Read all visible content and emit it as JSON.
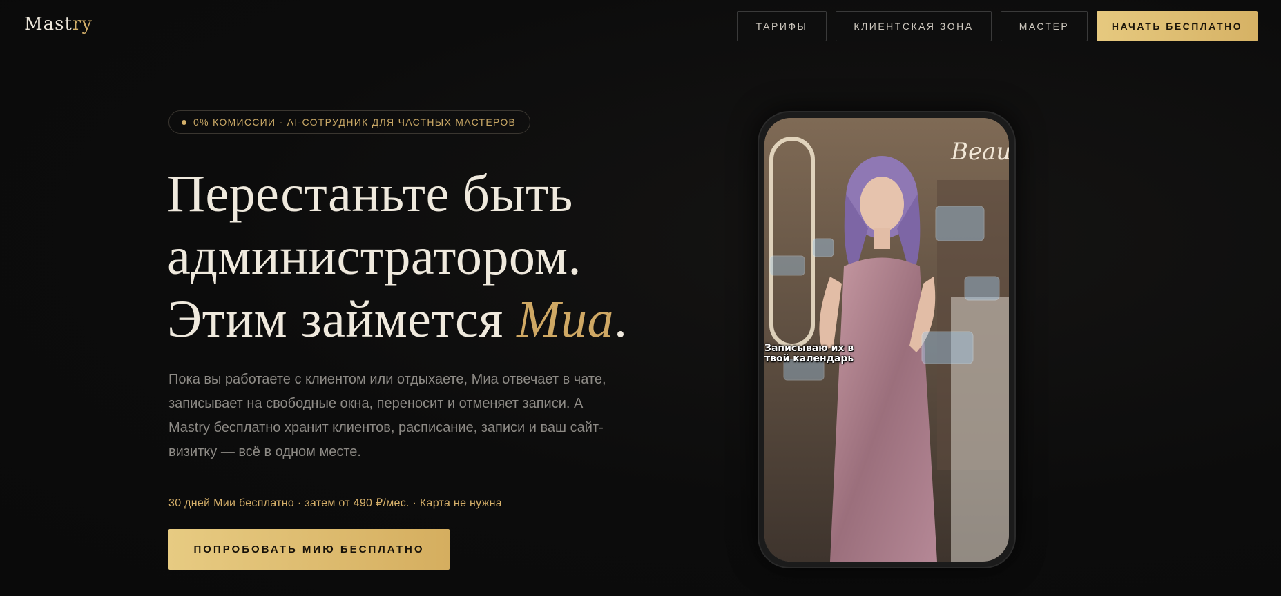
{
  "header": {
    "logo_main": "Mast",
    "logo_accent": "ry",
    "nav": {
      "pricing": "ТАРИФЫ",
      "client_zone": "КЛИЕНТСКАЯ ЗОНА",
      "master": "МАСТЕР",
      "start_free": "НАЧАТЬ БЕСПЛАТНО"
    }
  },
  "hero": {
    "badge": "0% КОМИССИИ · AI-СОТРУДНИК ДЛЯ ЧАСТНЫХ МАСТЕРОВ",
    "headline_line1": "Перестаньте быть",
    "headline_line2": "администратором.",
    "headline_line3_prefix": "Этим займется ",
    "headline_accent": "Миа",
    "headline_period": ".",
    "description": "Пока вы работаете с клиентом или отдыхаете, Миа отвечает в чате, записывает на свободные окна, переносит и отменяет записи. А Mastry бесплатно хранит клиентов, расписание, записи и ваш сайт-визитку — всё в одном месте.",
    "offer": "30 дней Мии бесплатно · затем от 490 ₽/мес. · Карта не нужна",
    "cta": "ПОПРОБОВАТЬ МИЮ БЕСПЛАТНО"
  },
  "phone": {
    "caption": "Записываю их в твой календарь",
    "sign_text": "Beauty"
  },
  "colors": {
    "background": "#0b0b0b",
    "gold": "#d4b06a",
    "text": "#efe9dd",
    "muted": "#8d8a85"
  }
}
